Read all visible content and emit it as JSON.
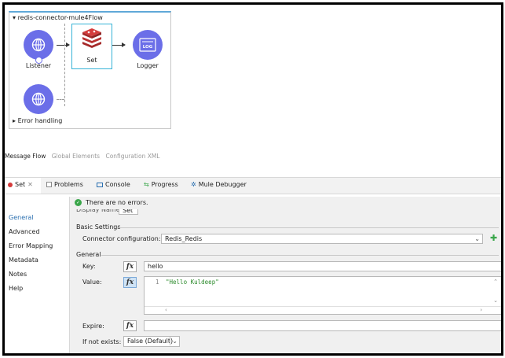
{
  "flow": {
    "title": "redis-connector-mule4Flow",
    "nodes": [
      {
        "label": "Listener"
      },
      {
        "label": "Set"
      },
      {
        "label": "Logger"
      }
    ],
    "error_handling_label": "Error handling"
  },
  "editor_tabs": {
    "message_flow": "Message Flow",
    "global_elements": "Global Elements",
    "configuration_xml": "Configuration XML"
  },
  "panel_tabs": {
    "set": "Set",
    "problems": "Problems",
    "console": "Console",
    "progress": "Progress",
    "mule_debugger": "Mule Debugger"
  },
  "sidebar": {
    "items": [
      "General",
      "Advanced",
      "Error Mapping",
      "Metadata",
      "Notes",
      "Help"
    ]
  },
  "form": {
    "status": "There are no errors.",
    "display_name_label": "Display Name:",
    "display_name_value": "Set",
    "basic_settings_title": "Basic Settings",
    "connector_config_label": "Connector configuration:",
    "connector_config_value": "Redis_Redis",
    "general_title": "General",
    "key_label": "Key:",
    "key_value": "hello",
    "value_label": "Value:",
    "value_line_number": "1",
    "value_code": "\"Hello Kuldeep\"",
    "expire_label": "Expire:",
    "expire_value": "",
    "if_not_exists_label": "If not exists:",
    "if_not_exists_value": "False (Default)"
  },
  "colors": {
    "node": "#6b6ee8",
    "set_icon": "#d43b3b",
    "selection": "#36b3d6",
    "link": "#2a6fb0",
    "ok": "#3aa64a",
    "code_string": "#2a8a2a"
  }
}
